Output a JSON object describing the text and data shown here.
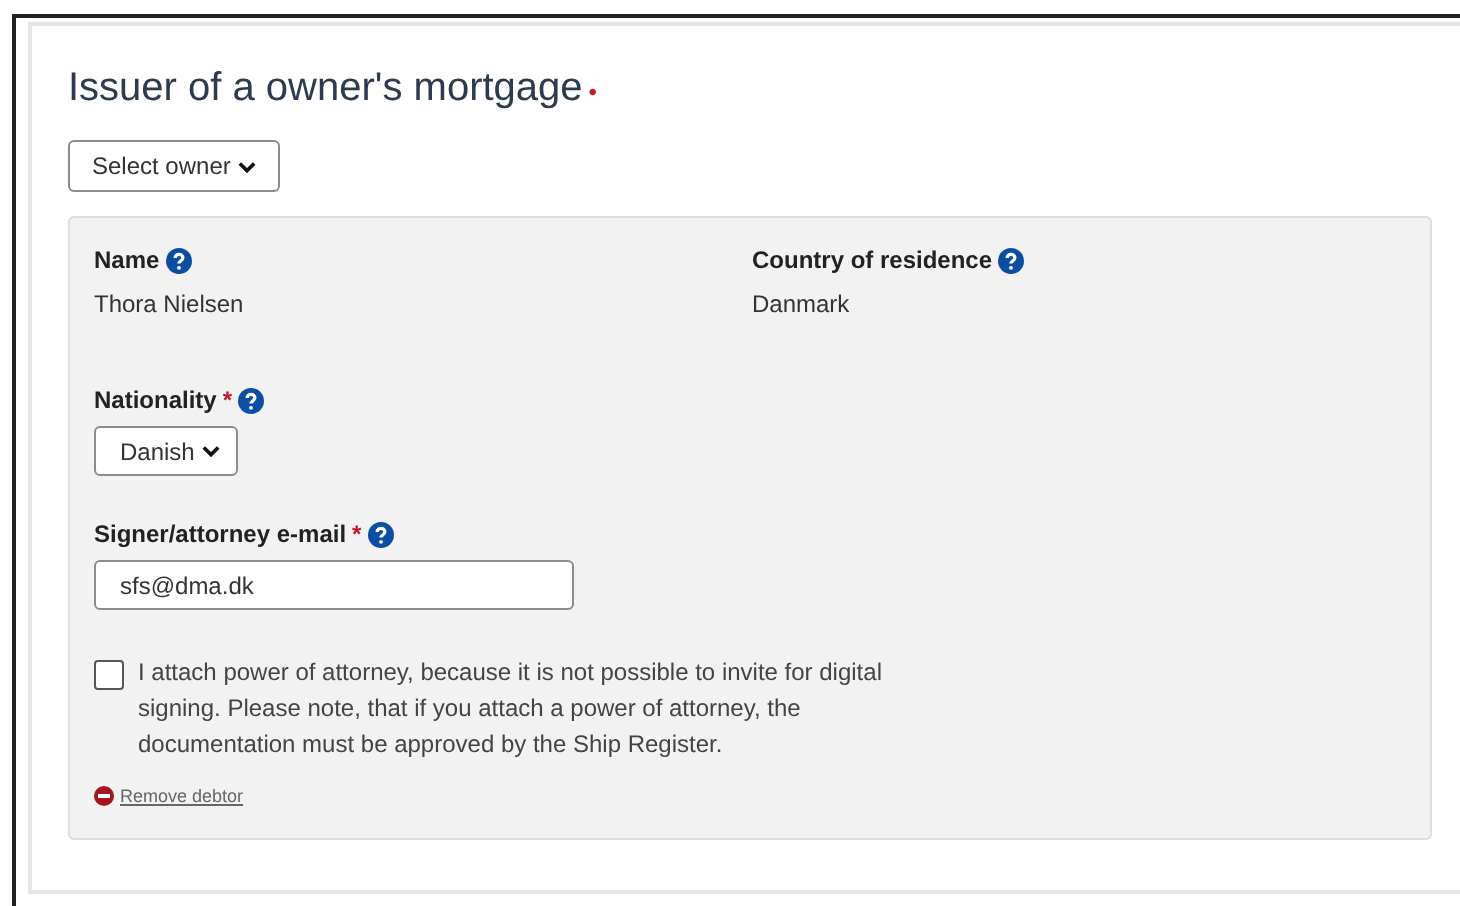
{
  "section": {
    "title": "Issuer of a owner's mortgage",
    "required_mark": "•"
  },
  "owner_select": {
    "label": "Select owner"
  },
  "debtor": {
    "fields": [
      {
        "label": "Name",
        "value": "Thora Nielsen"
      },
      {
        "label": "Country of residence",
        "value": "Danmark"
      }
    ],
    "nationality": {
      "label": "Nationality",
      "required_mark": "*",
      "value": "Danish"
    },
    "email": {
      "label": "Signer/attorney e-mail",
      "required_mark": "*",
      "value": "sfs@dma.dk"
    },
    "attorney_checkbox": {
      "checked": false,
      "label": "I attach power of attorney, because it is not possible to invite for digital signing. Please note, that if you attach a power of attorney, the documentation must be approved by the Ship Register."
    },
    "remove_link": "Remove debtor"
  }
}
